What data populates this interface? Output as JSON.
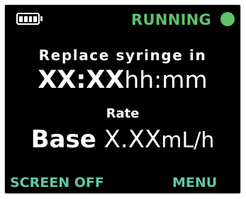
{
  "status": {
    "state_label": "RUNNING",
    "state_color": "#5fc46a",
    "battery_icon": "battery-full-icon",
    "battery_cells": 4
  },
  "main": {
    "replace_label": "Replace syringe in",
    "time_value": "XX:XX",
    "time_unit": "hh:mm",
    "rate_label": "Rate",
    "rate_mode": "Base",
    "rate_value": "X.XX",
    "rate_unit": "mL/h"
  },
  "softkeys": {
    "left_label": "SCREEN OFF",
    "right_label": "MENU",
    "color": "#5fc8a4"
  }
}
